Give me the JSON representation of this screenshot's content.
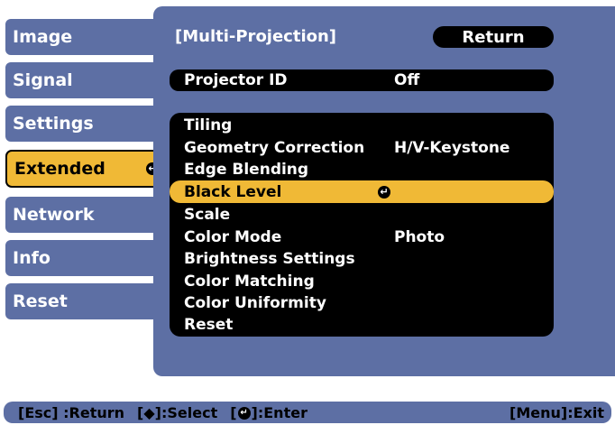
{
  "sidebar": {
    "items": [
      {
        "label": "Image",
        "active": false
      },
      {
        "label": "Signal",
        "active": false
      },
      {
        "label": "Settings",
        "active": false
      },
      {
        "label": "Extended",
        "active": true
      },
      {
        "label": "Network",
        "active": false
      },
      {
        "label": "Info",
        "active": false
      },
      {
        "label": "Reset",
        "active": false
      }
    ]
  },
  "panel": {
    "title": "[Multi-Projection]",
    "return_label": "Return",
    "projector_id": {
      "label": "Projector ID",
      "value": "Off"
    },
    "menu_items": [
      {
        "label": "Tiling",
        "value": ""
      },
      {
        "label": "Geometry Correction",
        "value": "H/V-Keystone"
      },
      {
        "label": "Edge Blending",
        "value": ""
      },
      {
        "label": "Black Level",
        "value": "",
        "selected": true
      },
      {
        "label": "Scale",
        "value": ""
      },
      {
        "label": "Color Mode",
        "value": "Photo"
      },
      {
        "label": "Brightness Settings",
        "value": ""
      },
      {
        "label": "Color Matching",
        "value": ""
      },
      {
        "label": "Color Uniformity",
        "value": ""
      },
      {
        "label": "Reset",
        "value": ""
      }
    ]
  },
  "footer": {
    "esc": "[Esc] :Return",
    "select_prefix": "[",
    "select_arrow": "◆",
    "select_suffix": "]:Select",
    "enter_prefix": "[",
    "enter_suffix": "]:Enter",
    "exit": "[Menu]:Exit"
  },
  "colors": {
    "panel": "#5d6fa4",
    "highlight": "#f0b936",
    "row": "#000000"
  }
}
